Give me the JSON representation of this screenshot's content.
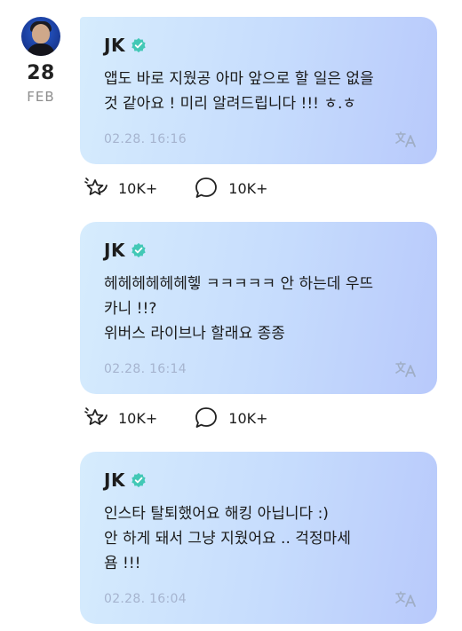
{
  "profile": {
    "avatar_icon": "user-avatar",
    "date_day": "28",
    "date_month": "FEB"
  },
  "posts": [
    {
      "author": "JK",
      "text": "앱도 바로 지웠공 아마 앞으로 할 일은 없을\n것 같아요 ! 미리 알려드립니다 !!! ㅎ.ㅎ",
      "timestamp": "02.28. 16:16",
      "likes": "10K+",
      "comments": "10K+"
    },
    {
      "author": "JK",
      "text": "헤헤헤헤헤헤헿 ㅋㅋㅋㅋㅋ 안 하는데 우뜨\n카니 !!?\n위버스 라이브나 할래요 종종",
      "timestamp": "02.28. 16:14",
      "likes": "10K+",
      "comments": "10K+"
    },
    {
      "author": "JK",
      "text": "인스타 탈퇴했어요 해킹 아닙니다 :)\n안 하게 돼서 그냥 지웠어요 .. 걱정마세\n욤 !!!",
      "timestamp": "02.28. 16:04"
    }
  ],
  "colors": {
    "verified": "#42c8b6",
    "timestamp": "#a6b4cf",
    "translate": "#a0aec6"
  }
}
